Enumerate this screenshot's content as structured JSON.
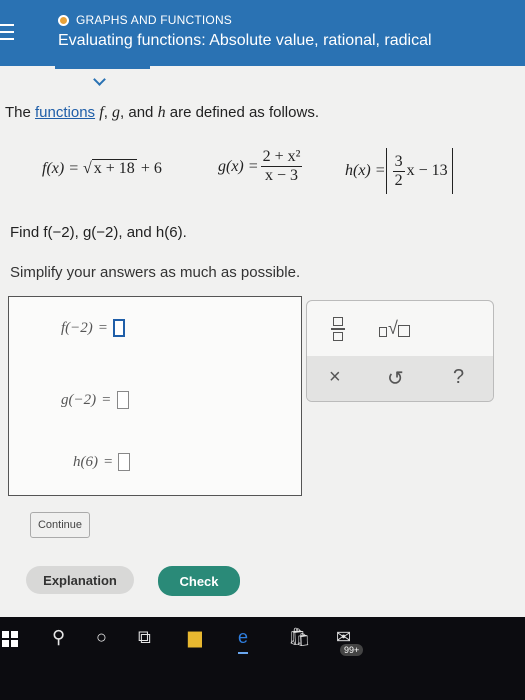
{
  "header": {
    "topic": "GRAPHS AND FUNCTIONS",
    "title": "Evaluating functions: Absolute value, rational, radical"
  },
  "problem": {
    "intro_pre": "The ",
    "intro_link": "functions",
    "intro_post": " are defined as follows.",
    "f_label": "f(x) = ",
    "f_radicand": "x + 18",
    "f_tail": " + 6",
    "g_label": "g(x) = ",
    "g_num": "2 + x²",
    "g_den": "x − 3",
    "h_label": "h(x) = ",
    "h_num": "3",
    "h_den": "2",
    "h_tail": "x − 13",
    "find_text": "Find f(−2), g(−2), and h(6).",
    "simplify_text": "Simplify your answers as much as possible."
  },
  "answers": {
    "f_label": "f(−2)",
    "g_label": "g(−2)",
    "h_label": "h(6)",
    "equals": "="
  },
  "tools": {
    "clear": "×",
    "undo": "↺",
    "help": "?"
  },
  "buttons": {
    "continue": "Continue",
    "explanation": "Explanation",
    "check": "Check"
  },
  "taskbar": {
    "badge": "99+"
  }
}
